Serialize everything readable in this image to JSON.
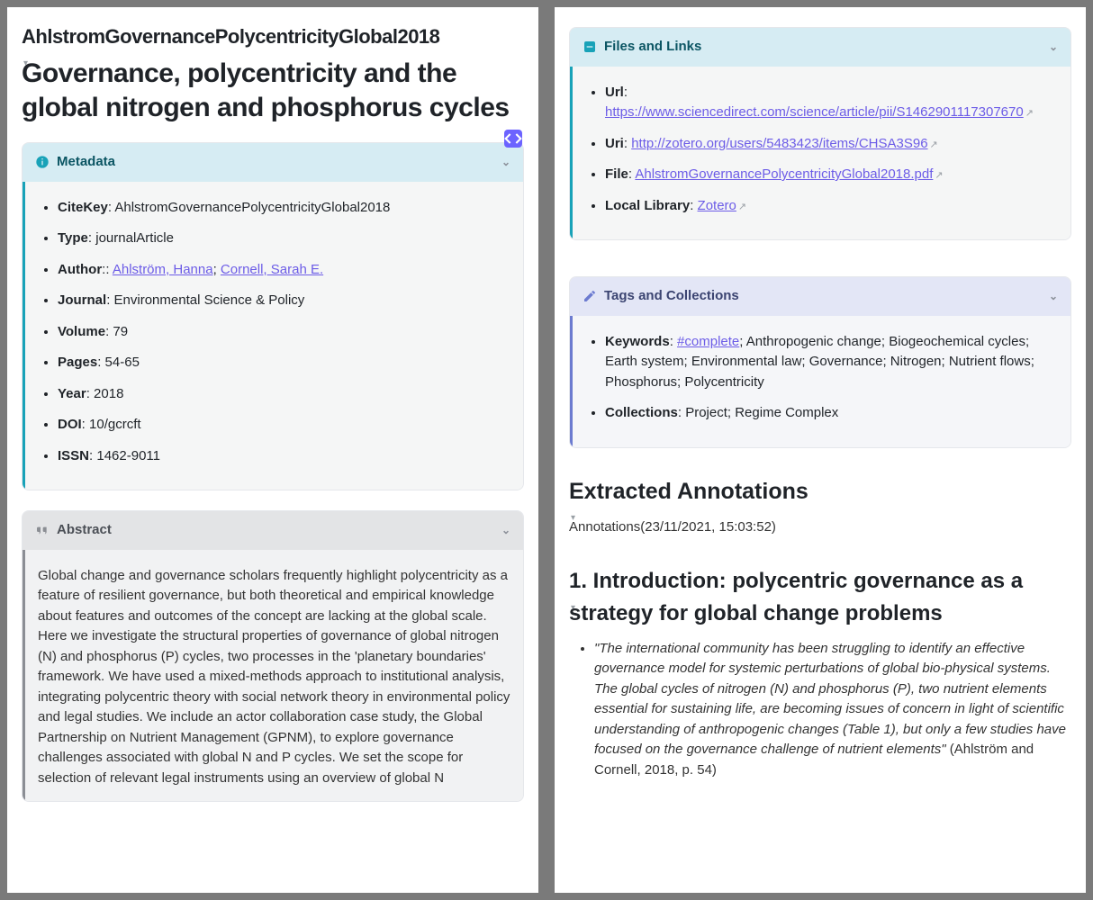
{
  "citekey_line": "AhlstromGovernancePolycentricityGlobal2018",
  "title": "Governance, polycentricity and the global nitrogen and phosphorus cycles",
  "callouts": {
    "metadata": {
      "title": "Metadata"
    },
    "abstract": {
      "title": "Abstract"
    },
    "files": {
      "title": "Files and Links"
    },
    "tags": {
      "title": "Tags and Collections"
    }
  },
  "metadata": {
    "citekey_label": "CiteKey",
    "citekey": "AhlstromGovernancePolycentricityGlobal2018",
    "type_label": "Type",
    "type": "journalArticle",
    "author_label": "Author",
    "authors": [
      "Ahlström, Hanna",
      "Cornell, Sarah E."
    ],
    "journal_label": "Journal",
    "journal": "Environmental Science & Policy",
    "volume_label": "Volume",
    "volume": "79",
    "pages_label": "Pages",
    "pages": "54-65",
    "year_label": "Year",
    "year": "2018",
    "doi_label": "DOI",
    "doi": "10/gcrcft",
    "issn_label": "ISSN",
    "issn": "1462-9011"
  },
  "abstract": "Global change and governance scholars frequently highlight polycentricity as a feature of resilient governance, but both theoretical and empirical knowledge about features and outcomes of the concept are lacking at the global scale. Here we investigate the structural properties of governance of global nitrogen (N) and phosphorus (P) cycles, two processes in the 'planetary boundaries' framework. We have used a mixed-methods approach to institutional analysis, integrating polycentric theory with social network theory in environmental policy and legal studies. We include an actor collaboration case study, the Global Partnership on Nutrient Management (GPNM), to explore governance challenges associated with global N and P cycles. We set the scope for selection of relevant legal instruments using an overview of global N",
  "files": {
    "url_label": "Url",
    "url": "https://www.sciencedirect.com/science/article/pii/S1462901117307670",
    "uri_label": "Uri",
    "uri": "http://zotero.org/users/5483423/items/CHSA3S96",
    "file_label": "File",
    "file": "AhlstromGovernancePolycentricityGlobal2018.pdf",
    "local_label": "Local Library",
    "local": "Zotero"
  },
  "tags": {
    "keywords_label": "Keywords",
    "keyword_tag": "#complete",
    "keywords_rest": "; Anthropogenic change; Biogeochemical cycles; Earth system; Environmental law; Governance; Nitrogen; Nutrient flows; Phosphorus; Polycentricity",
    "collections_label": "Collections",
    "collections": "Project; Regime Complex"
  },
  "annotations": {
    "heading": "Extracted Annotations",
    "timestamp": "Annotations(23/11/2021, 15:03:52)",
    "section1_heading": "1. Introduction: polycentric governance as a strategy for global change problems",
    "quote1_text": "\"The international community has been struggling to identify an effective governance model for systemic perturbations of global bio-physical systems. The global cycles of nitrogen (N) and phosphorus (P), two nutrient elements essential for sustaining life, are becoming issues of concern in light of scientific understanding of anthropogenic changes (Table 1), but only a few studies have focused on the governance challenge of nutrient elements\"",
    "quote1_cite": " (Ahlström and Cornell, 2018, p. 54)"
  }
}
